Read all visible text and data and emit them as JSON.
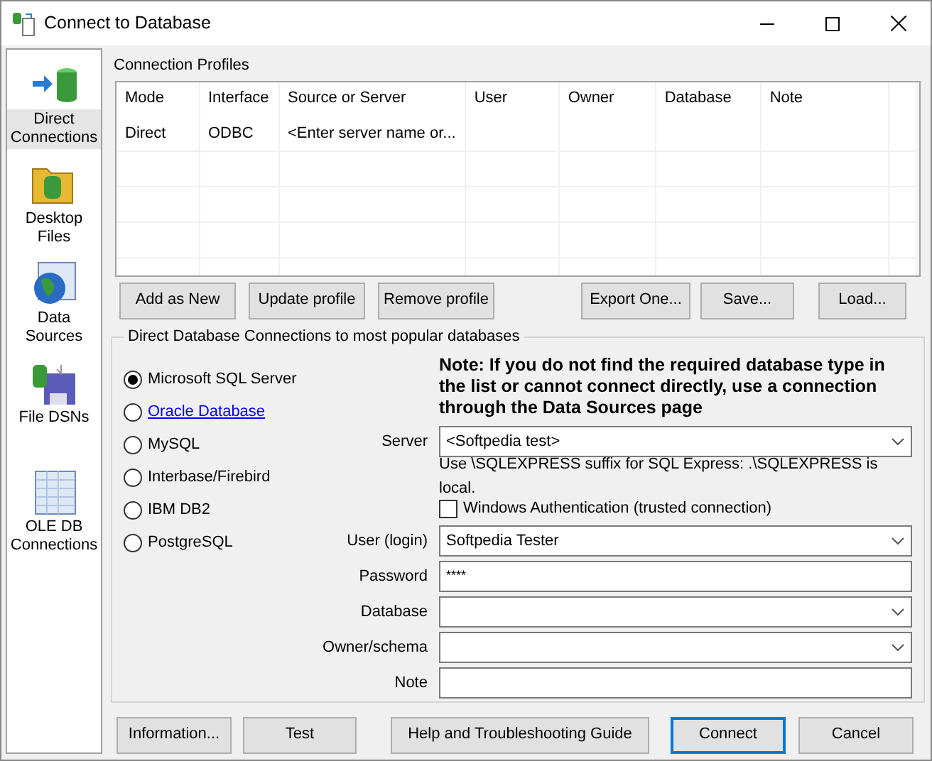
{
  "window": {
    "title": "Connect to Database"
  },
  "sidebar": {
    "items": [
      {
        "label": "Direct Connections",
        "selected": true
      },
      {
        "label": "Desktop Files",
        "selected": false
      },
      {
        "label": "Data Sources",
        "selected": false
      },
      {
        "label": "File DSNs",
        "selected": false
      },
      {
        "label": "OLE DB Connections",
        "selected": false
      }
    ]
  },
  "profiles": {
    "title": "Connection Profiles",
    "columns": [
      "Mode",
      "Interface",
      "Source or Server",
      "User",
      "Owner",
      "Database",
      "Note"
    ],
    "rows": [
      [
        "Direct",
        "ODBC",
        "<Enter server name or...",
        "",
        "",
        "",
        ""
      ]
    ],
    "buttons": [
      "Add as New",
      "Update profile",
      "Remove profile",
      "Export One...",
      "Save...",
      "Load..."
    ]
  },
  "direct": {
    "title": "Direct Database Connections to most popular databases",
    "databases": [
      {
        "label": "Microsoft SQL Server",
        "kind": "plain",
        "selected": true
      },
      {
        "label": "Oracle Database",
        "kind": "link",
        "selected": false
      },
      {
        "label": "MySQL",
        "kind": "plain",
        "selected": false
      },
      {
        "label": "Interbase/Firebird",
        "kind": "plain",
        "selected": false
      },
      {
        "label": "IBM DB2",
        "kind": "plain",
        "selected": false
      },
      {
        "label": "PostgreSQL",
        "kind": "plain",
        "selected": false
      }
    ],
    "note": "Note: If you do not find the required database type in the list or cannot connect directly, use a connection through the Data Sources page",
    "form": [
      {
        "kind": "combo",
        "label": "Server",
        "value": "<Softpedia test>"
      },
      {
        "kind": "hint",
        "text": "Use \\SQLEXPRESS suffix for SQL Express: .\\SQLEXPRESS is local."
      },
      {
        "kind": "checkbox",
        "text": "Windows Authentication (trusted connection)",
        "checked": false
      },
      {
        "kind": "combo",
        "label": "User (login)",
        "value": "Softpedia Tester"
      },
      {
        "kind": "text",
        "label": "Password",
        "value": "****"
      },
      {
        "kind": "combo",
        "label": "Database"
      },
      {
        "kind": "combo",
        "label": "Owner/schema"
      },
      {
        "kind": "text",
        "label": "Note"
      }
    ]
  },
  "footer_buttons": [
    {
      "label": "Information...",
      "default": false
    },
    {
      "label": "Test",
      "default": false
    },
    {
      "label": "Help and Troubleshooting Guide",
      "default": false
    },
    {
      "label": "Connect",
      "default": true
    },
    {
      "label": "Cancel",
      "default": false
    }
  ]
}
